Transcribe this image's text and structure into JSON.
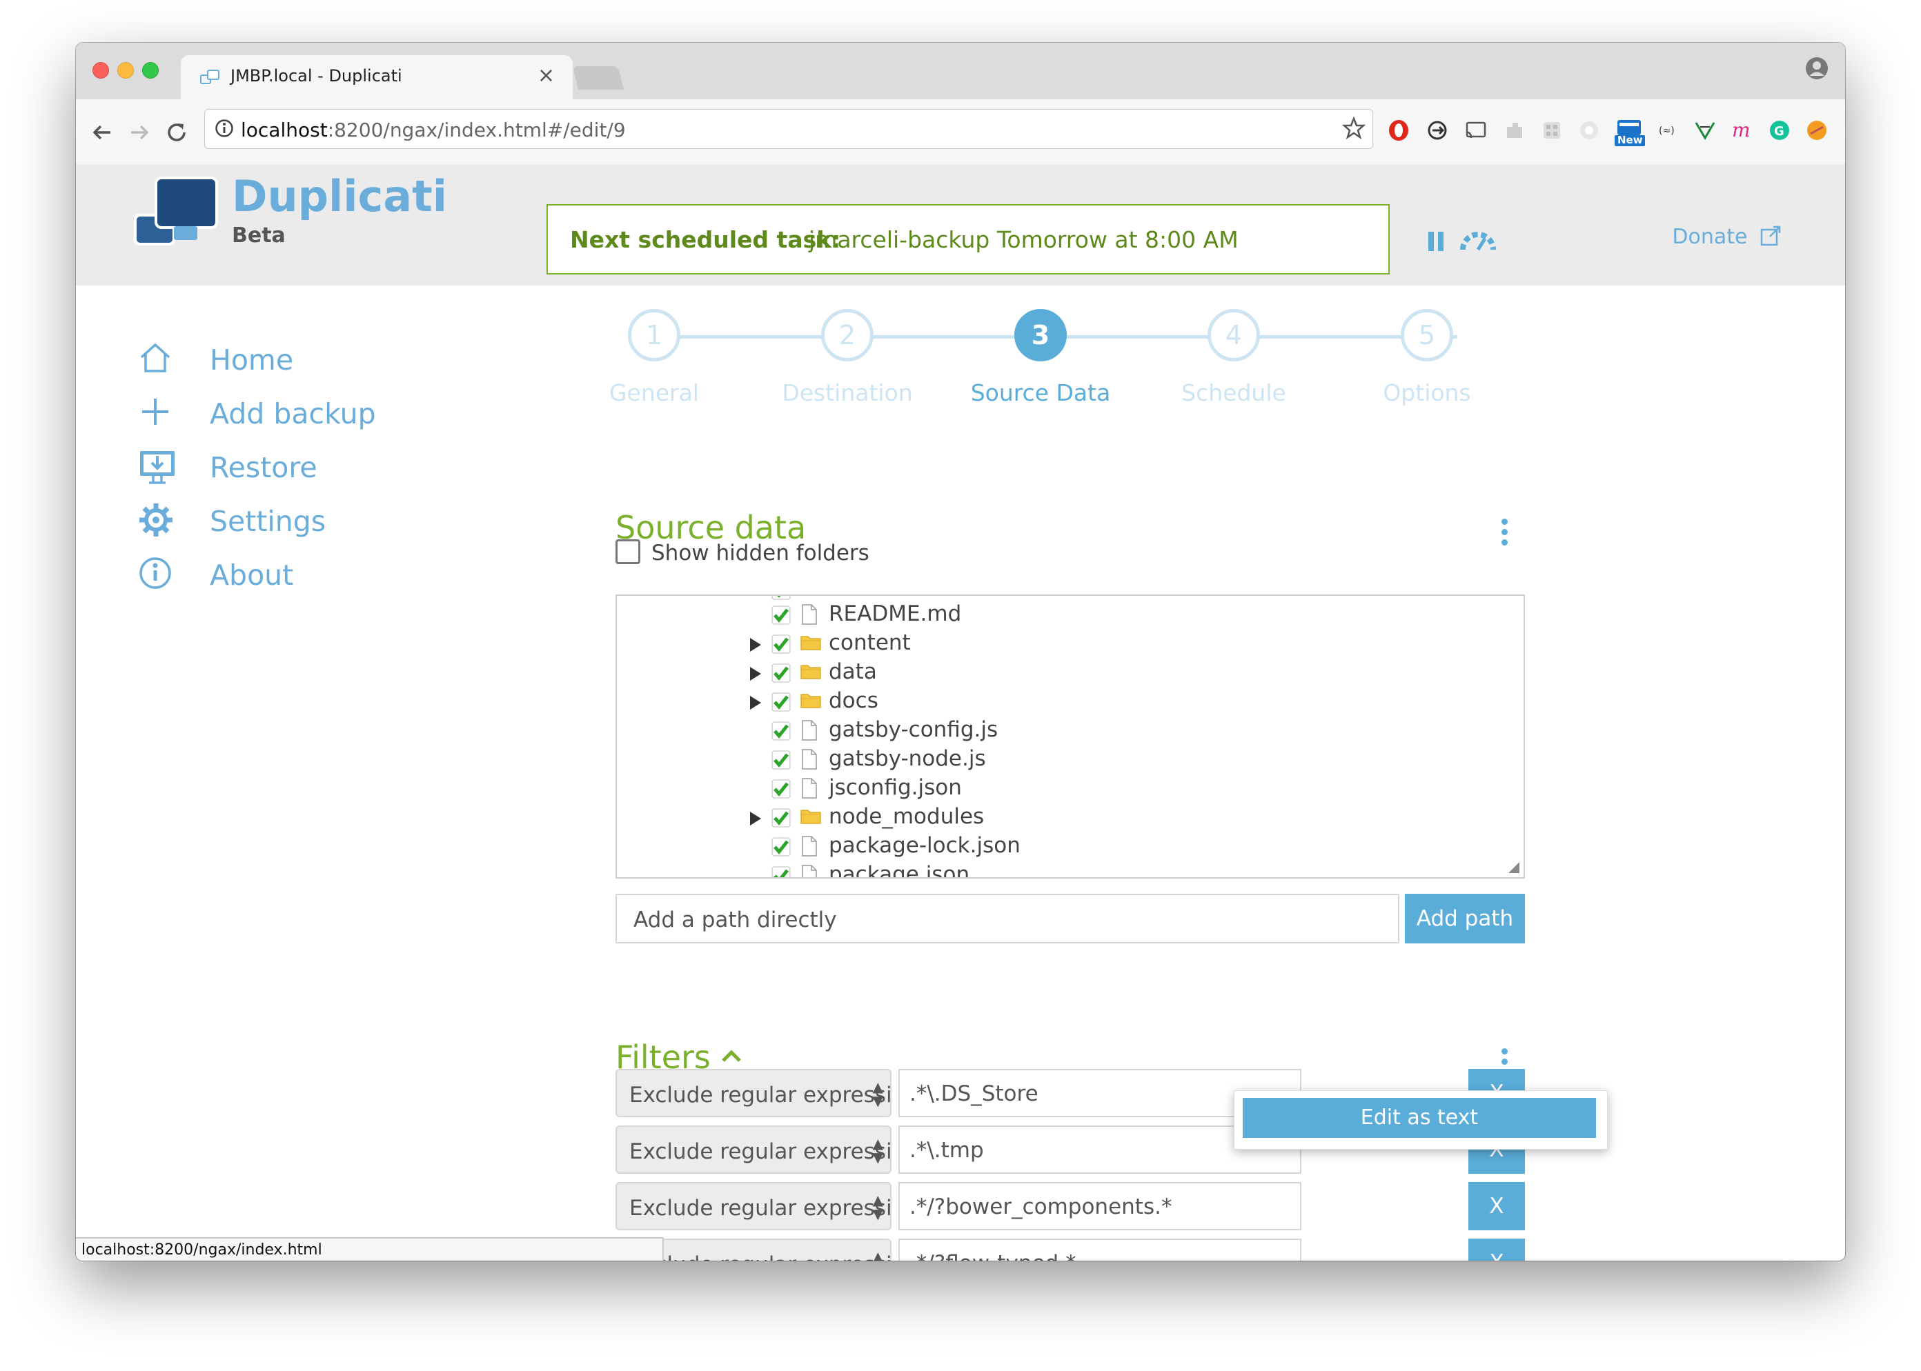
{
  "browser": {
    "tab_title": "JMBP.local - Duplicati",
    "tab_close": "×",
    "url_host": "localhost",
    "url_rest": ":8200/ngax/index.html#/edit/9",
    "ext_new_badge": "New",
    "status_url": "localhost:8200/ngax/index.html"
  },
  "app": {
    "name": "Duplicati",
    "badge": "Beta",
    "schedule_label": "Next scheduled task:",
    "schedule_task": "jmarceli-backup Tomorrow at 8:00 AM",
    "donate": "Donate"
  },
  "sidebar": {
    "items": [
      {
        "label": "Home",
        "icon": "home-icon"
      },
      {
        "label": "Add backup",
        "icon": "plus-icon"
      },
      {
        "label": "Restore",
        "icon": "restore-icon"
      },
      {
        "label": "Settings",
        "icon": "gear-icon"
      },
      {
        "label": "About",
        "icon": "info-icon"
      }
    ]
  },
  "steps": [
    {
      "num": "1",
      "label": "General"
    },
    {
      "num": "2",
      "label": "Destination"
    },
    {
      "num": "3",
      "label": "Source Data",
      "active": true
    },
    {
      "num": "4",
      "label": "Schedule"
    },
    {
      "num": "5",
      "label": "Options"
    }
  ],
  "source": {
    "title": "Source data",
    "show_hidden": "Show hidden folders",
    "tree": [
      {
        "name": "README.md",
        "type": "file",
        "expand": false
      },
      {
        "name": "content",
        "type": "folder",
        "expand": true
      },
      {
        "name": "data",
        "type": "folder",
        "expand": true
      },
      {
        "name": "docs",
        "type": "folder",
        "expand": true
      },
      {
        "name": "gatsby-config.js",
        "type": "file",
        "expand": false
      },
      {
        "name": "gatsby-node.js",
        "type": "file",
        "expand": false
      },
      {
        "name": "jsconfig.json",
        "type": "file",
        "expand": false
      },
      {
        "name": "node_modules",
        "type": "folder",
        "expand": true
      },
      {
        "name": "package-lock.json",
        "type": "file",
        "expand": false
      },
      {
        "name": "package.json",
        "type": "file",
        "expand": false
      }
    ],
    "add_path_placeholder": "Add a path directly",
    "add_path_button": "Add path"
  },
  "filters": {
    "title": "Filters",
    "menu_item": "Edit as text",
    "remove_label": "X",
    "rows": [
      {
        "type": "Exclude regular expression",
        "value": ".*\\.DS_Store"
      },
      {
        "type": "Exclude regular expression",
        "value": ".*\\.tmp"
      },
      {
        "type": "Exclude regular expression",
        "value": ".*/?bower_components.*"
      },
      {
        "type": "Exclude regular expression",
        "value": ".*/?flow-typed.*"
      }
    ]
  },
  "colors": {
    "accent_blue": "#5badd9",
    "accent_green": "#7ab02c",
    "step_inactive": "#cde4f3"
  }
}
